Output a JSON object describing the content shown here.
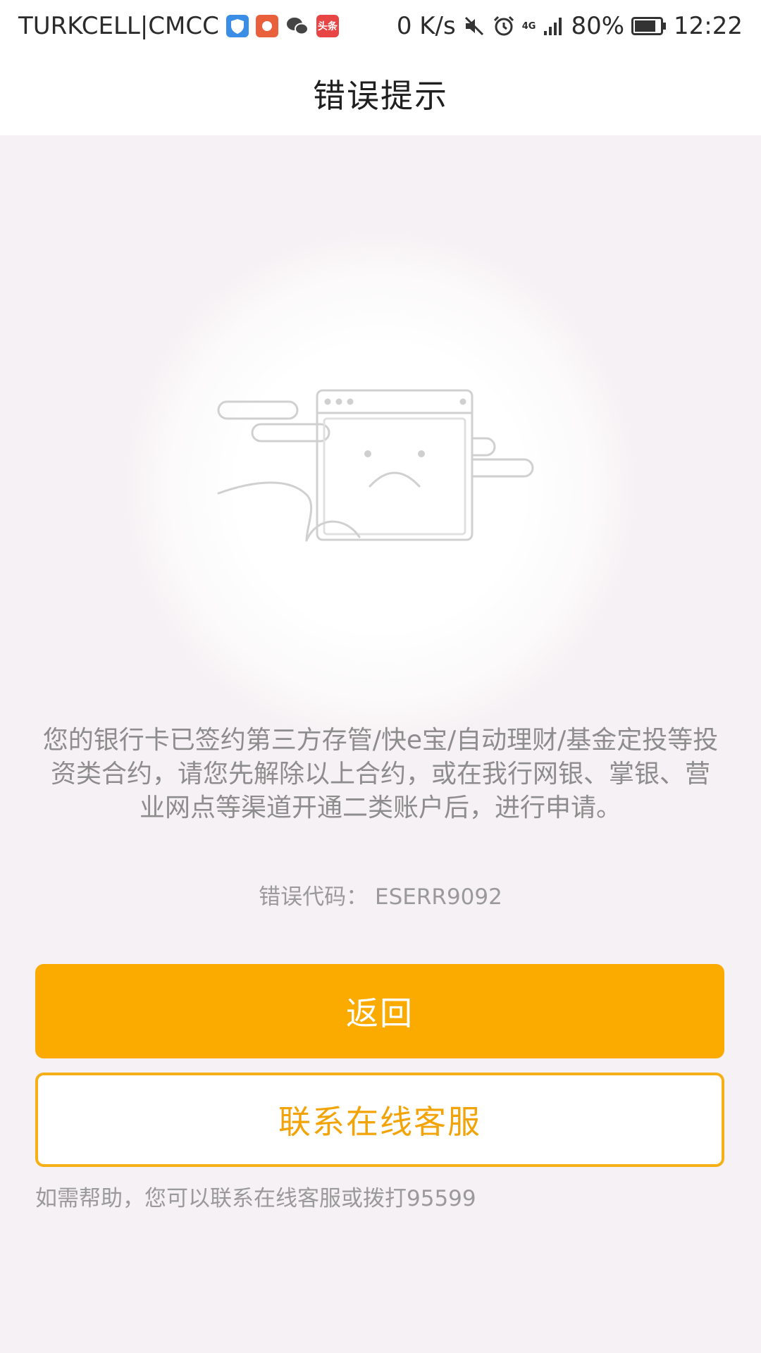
{
  "status_bar": {
    "carrier": "TURKCELL|CMCC",
    "app_badge_label": "头条",
    "net_speed": "0 K/s",
    "network_type": "4G",
    "battery": "80%",
    "time": "12:22"
  },
  "header": {
    "title": "错误提示"
  },
  "error": {
    "message": "您的银行卡已签约第三方存管/快e宝/自动理财/基金定投等投资类合约，请您先解除以上合约，或在我行网银、掌银、营业网点等渠道开通二类账户后，进行申请。",
    "code_label": "错误代码：",
    "code": "ESERR9092"
  },
  "buttons": {
    "back": "返回",
    "contact": "联系在线客服"
  },
  "help_text": "如需帮助，您可以联系在线客服或拨打95599",
  "colors": {
    "accent": "#fbaa00",
    "page_bg": "#f6f1f4",
    "muted_text": "#8d8d8d"
  }
}
